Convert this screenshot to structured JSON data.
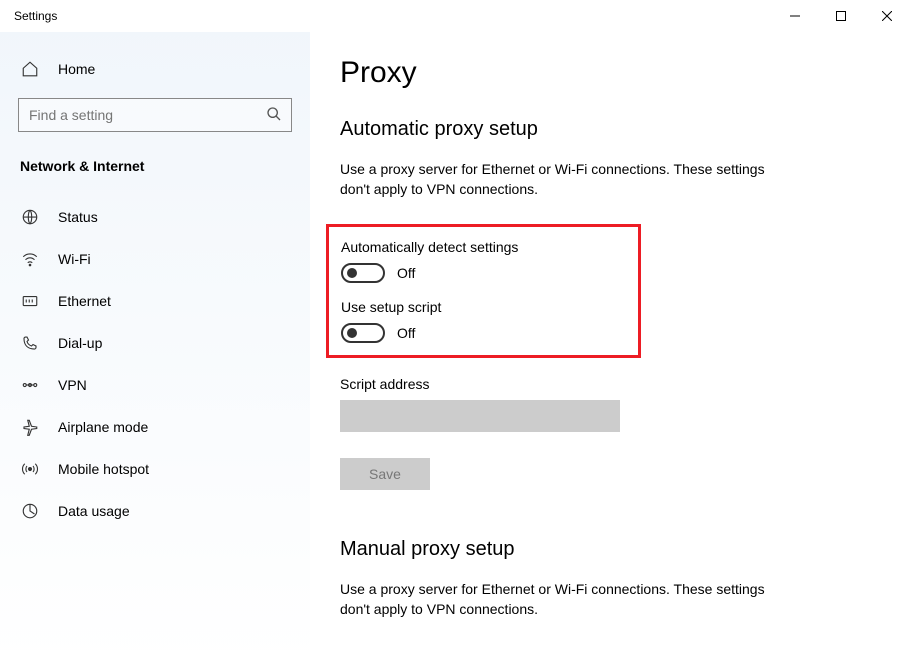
{
  "titlebar": {
    "title": "Settings"
  },
  "sidebar": {
    "home": "Home",
    "search_placeholder": "Find a setting",
    "section": "Network & Internet",
    "items": [
      {
        "label": "Status"
      },
      {
        "label": "Wi-Fi"
      },
      {
        "label": "Ethernet"
      },
      {
        "label": "Dial-up"
      },
      {
        "label": "VPN"
      },
      {
        "label": "Airplane mode"
      },
      {
        "label": "Mobile hotspot"
      },
      {
        "label": "Data usage"
      }
    ]
  },
  "main": {
    "title": "Proxy",
    "auto_section": "Automatic proxy setup",
    "auto_desc": "Use a proxy server for Ethernet or Wi-Fi connections. These settings don't apply to VPN connections.",
    "detect_label": "Automatically detect settings",
    "detect_state": "Off",
    "script_label": "Use setup script",
    "script_state": "Off",
    "script_address_label": "Script address",
    "save_label": "Save",
    "manual_section": "Manual proxy setup",
    "manual_desc": "Use a proxy server for Ethernet or Wi-Fi connections. These settings don't apply to VPN connections."
  }
}
